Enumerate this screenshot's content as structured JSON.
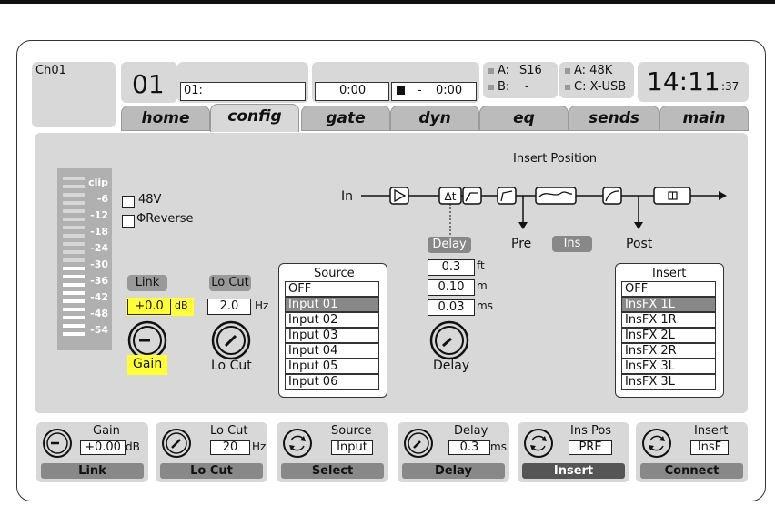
{
  "header": {
    "channel_name": "Ch01",
    "channel_number": "01",
    "scene_label": "01:",
    "time_elapsed": "0:00",
    "time_remaining": "0:00",
    "transport_separator": "-",
    "src_a": "A:",
    "src_a_val": "S16",
    "src_b": "B:",
    "src_b_val": "-",
    "rate_a": "A: 48K",
    "rate_c": "C: X-USB",
    "clock_time": "14:11",
    "clock_seconds": ":37"
  },
  "tabs": [
    {
      "label": "home"
    },
    {
      "label": "config"
    },
    {
      "label": "gate"
    },
    {
      "label": "dyn"
    },
    {
      "label": "eq"
    },
    {
      "label": "sends"
    },
    {
      "label": "main"
    }
  ],
  "meter": {
    "labels": [
      "clip",
      "-6",
      "-12",
      "-18",
      "-24",
      "-30",
      "-36",
      "-42",
      "-48",
      "-54"
    ]
  },
  "checkboxes": {
    "phantom": "48V",
    "reverse": "ΦReverse"
  },
  "gain": {
    "link_label": "Link",
    "value": "+0.0",
    "unit": "dB",
    "label": "Gain"
  },
  "locut": {
    "title": "Lo Cut",
    "value": "2.0",
    "unit": "Hz",
    "label": "Lo Cut"
  },
  "source": {
    "title": "Source",
    "items": [
      "OFF",
      "Input 01",
      "Input 02",
      "Input 03",
      "Input 04",
      "Input 05",
      "Input 06"
    ],
    "selected_index": 1
  },
  "delay": {
    "button": "Delay",
    "ft_value": "0.3",
    "ft_unit": "ft",
    "m_value": "0.10",
    "m_unit": "m",
    "ms_value": "0.03",
    "ms_unit": "ms",
    "label": "Delay"
  },
  "insert_position": {
    "title": "Insert Position",
    "in_label": "In",
    "pre_label": "Pre",
    "ins_label": "Ins",
    "post_label": "Post"
  },
  "insert": {
    "title": "Insert",
    "items": [
      "OFF",
      "InsFX 1L",
      "InsFX 1R",
      "InsFX 2L",
      "InsFX 2R",
      "InsFX 3L",
      "InsFX 3L"
    ],
    "selected_index": 1
  },
  "controls": [
    {
      "title": "Gain",
      "value": "+0.00",
      "unit": "dB",
      "foot": "Link"
    },
    {
      "title": "Lo Cut",
      "value": "20",
      "unit": "Hz",
      "foot": "Lo Cut"
    },
    {
      "title": "Source",
      "value": "Input",
      "unit": "",
      "foot": "Select"
    },
    {
      "title": "Delay",
      "value": "0.3",
      "unit": "ms",
      "foot": "Delay"
    },
    {
      "title": "Ins Pos",
      "value": "PRE",
      "unit": "",
      "foot": "Insert"
    },
    {
      "title": "Insert",
      "value": "InsF",
      "unit": "",
      "foot": "Connect"
    }
  ],
  "colors": {
    "highlight": "#ffff33",
    "panel": "#d8d8d8",
    "selected": "#888888"
  }
}
